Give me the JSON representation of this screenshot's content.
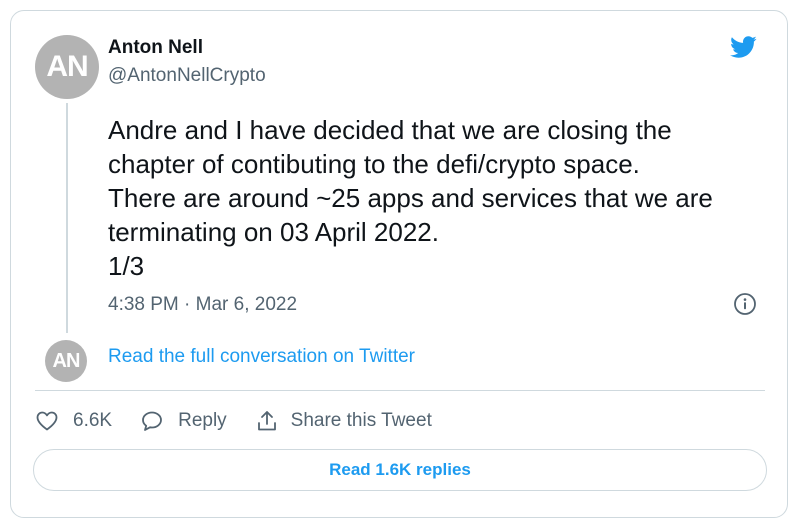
{
  "author": {
    "avatar_initials": "AN",
    "name": "Anton Nell",
    "handle": "@AntonNellCrypto"
  },
  "tweet": {
    "text": "Andre and I have decided that we are closing the\nchapter of contibuting to the defi/crypto space.\nThere are around ~25 apps and services that we are\nterminating on 03 April 2022.\n1/3",
    "timestamp": "4:38 PM · Mar 6, 2022"
  },
  "conversation": {
    "avatar_initials": "AN",
    "link_label": "Read the full conversation on Twitter"
  },
  "actions": {
    "like_count": "6.6K",
    "reply_label": "Reply",
    "share_label": "Share this Tweet"
  },
  "replies_button": {
    "label": "Read 1.6K replies"
  },
  "icons": {
    "brand": "twitter-bird-icon",
    "info": "info-icon",
    "like": "heart-icon",
    "reply": "speech-bubble-icon",
    "share": "share-upload-icon"
  },
  "colors": {
    "accent": "#1d9bf0",
    "text_primary": "#0f1419",
    "text_secondary": "#536471",
    "border": "#cfd9de",
    "avatar_bg": "#b3b3b3"
  }
}
